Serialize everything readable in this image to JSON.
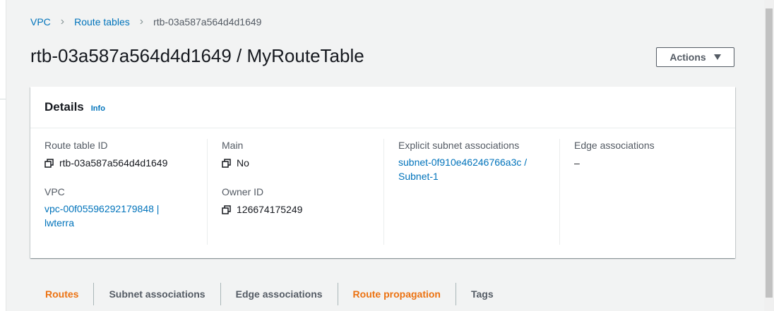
{
  "breadcrumb": {
    "items": [
      "VPC",
      "Route tables"
    ],
    "current": "rtb-03a587a564d4d1649"
  },
  "page": {
    "title": "rtb-03a587a564d4d1649 / MyRouteTable"
  },
  "actions": {
    "label": "Actions"
  },
  "details": {
    "title": "Details",
    "info_label": "Info",
    "route_table_id": {
      "label": "Route table ID",
      "value": "rtb-03a587a564d4d1649"
    },
    "vpc": {
      "label": "VPC",
      "value_line1": "vpc-00f05596292179848 |",
      "value_line2": "lwterra"
    },
    "main": {
      "label": "Main",
      "value": "No"
    },
    "owner_id": {
      "label": "Owner ID",
      "value": "126674175249"
    },
    "explicit_subnet": {
      "label": "Explicit subnet associations",
      "value_line1": "subnet-0f910e46246766a3c /",
      "value_line2": "Subnet-1"
    },
    "edge": {
      "label": "Edge associations",
      "value": "–"
    }
  },
  "tabs": [
    {
      "label": "Routes",
      "active": true
    },
    {
      "label": "Subnet associations",
      "active": false
    },
    {
      "label": "Edge associations",
      "active": false
    },
    {
      "label": "Route propagation",
      "active": true
    },
    {
      "label": "Tags",
      "active": false
    }
  ],
  "colors": {
    "link": "#0073bb",
    "active_tab": "#ec7211",
    "background": "#f2f3f3"
  }
}
